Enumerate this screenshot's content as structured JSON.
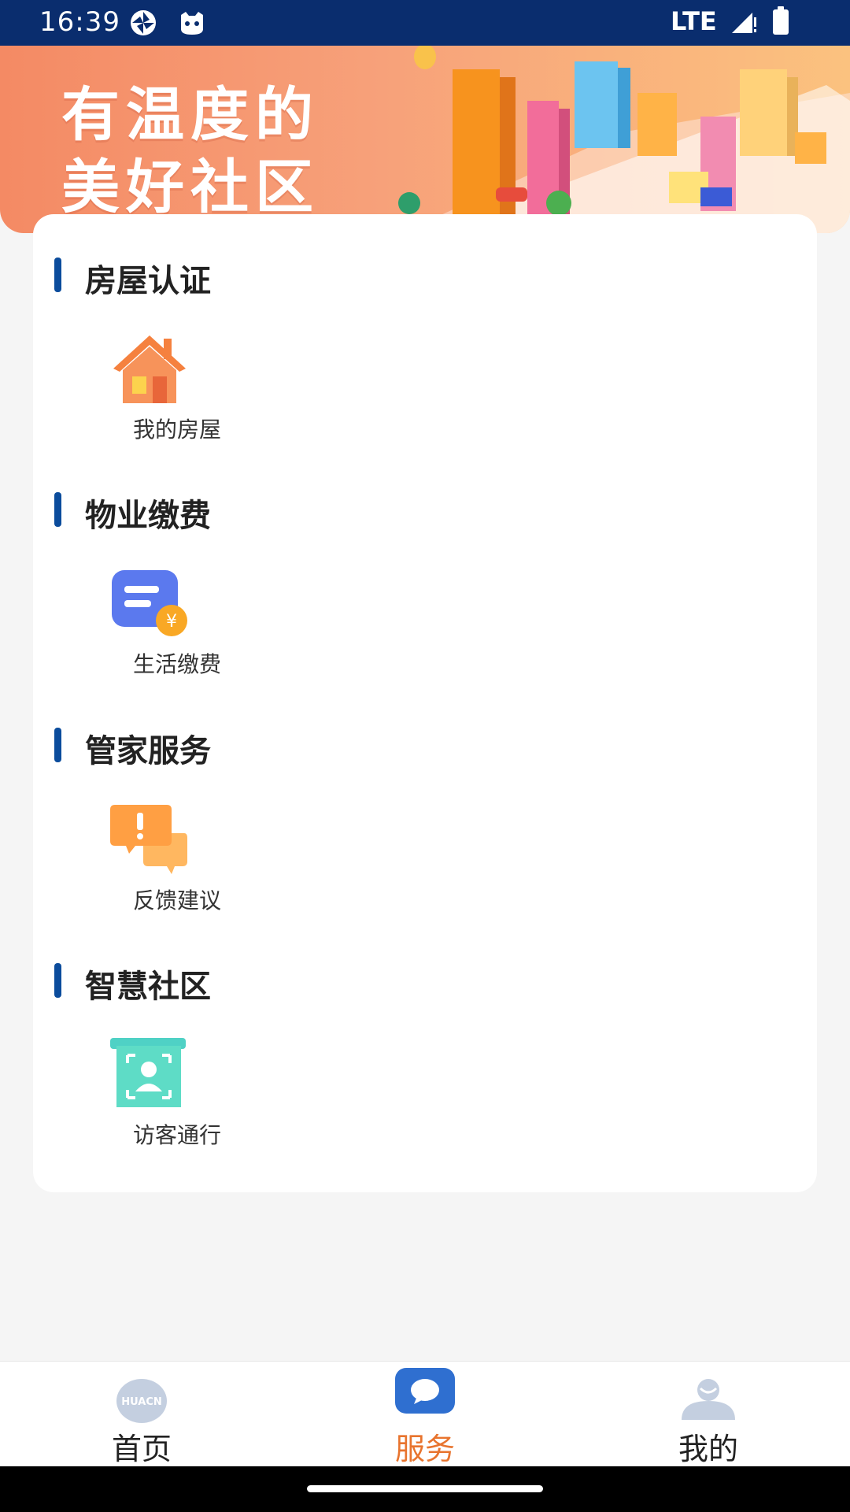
{
  "status_bar": {
    "time": "16:39",
    "network": "LTE",
    "icons": [
      "sync-icon",
      "cat-icon",
      "signal-icon",
      "battery-icon"
    ]
  },
  "banner": {
    "title_line1": "有温度的",
    "title_line2": "美好社区"
  },
  "sections": [
    {
      "title": "房屋认证",
      "items": [
        {
          "label": "我的房屋",
          "icon": "house-icon"
        }
      ]
    },
    {
      "title": "物业缴费",
      "items": [
        {
          "label": "生活缴费",
          "icon": "payment-bill-icon"
        }
      ]
    },
    {
      "title": "管家服务",
      "items": [
        {
          "label": "反馈建议",
          "icon": "feedback-chat-icon"
        }
      ]
    },
    {
      "title": "智慧社区",
      "items": [
        {
          "label": "访客通行",
          "icon": "visitor-pass-icon"
        }
      ]
    }
  ],
  "bottom_nav": {
    "items": [
      {
        "label": "首页",
        "icon": "huacn-logo-icon",
        "active": false,
        "icon_text": "HUACN"
      },
      {
        "label": "服务",
        "icon": "service-chat-icon",
        "active": true
      },
      {
        "label": "我的",
        "icon": "profile-icon",
        "active": false
      }
    ]
  },
  "colors": {
    "status_bar": "#0a2d6e",
    "section_accent": "#0b4c9c",
    "active_tab": "#e8742e"
  }
}
